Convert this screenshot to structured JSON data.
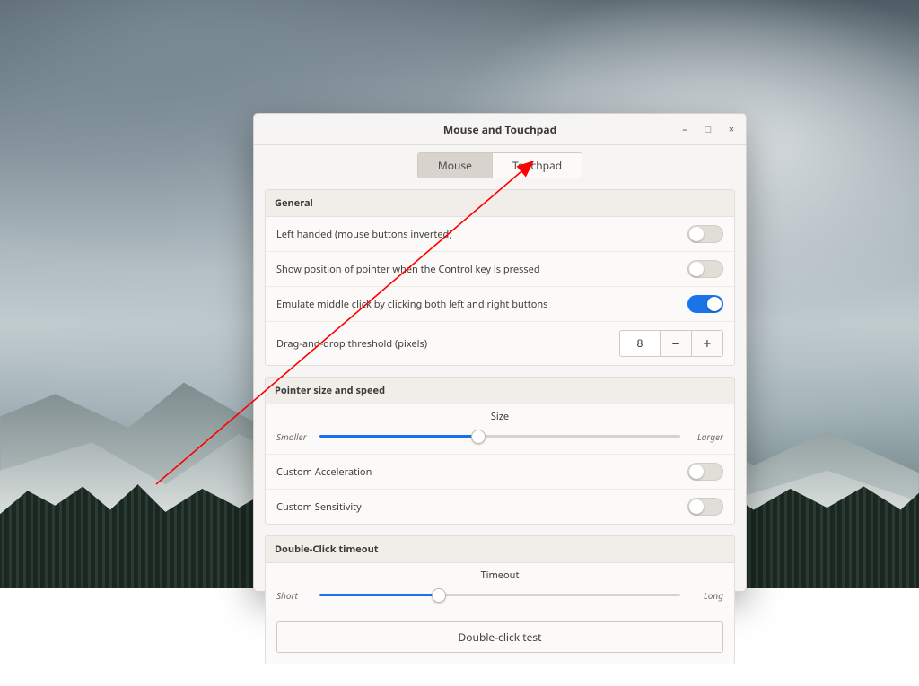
{
  "colors": {
    "accent": "#1a73e8",
    "annotation": "#ff0000"
  },
  "window": {
    "title": "Mouse and Touchpad",
    "controls": {
      "minimize": "–",
      "maximize": "□",
      "close": "×"
    },
    "tabs": [
      {
        "id": "mouse",
        "label": "Mouse",
        "active": true
      },
      {
        "id": "touchpad",
        "label": "Touchpad",
        "active": false
      }
    ]
  },
  "general": {
    "heading": "General",
    "rows": [
      {
        "id": "left-handed",
        "label": "Left handed (mouse buttons inverted)",
        "on": false
      },
      {
        "id": "show-position",
        "label": "Show position of pointer when the Control key is pressed",
        "on": false
      },
      {
        "id": "emulate-middle",
        "label": "Emulate middle click by clicking both left and right buttons",
        "on": true
      }
    ],
    "drag_threshold": {
      "label": "Drag-and-drop threshold (pixels)",
      "value": "8",
      "dec": "−",
      "inc": "+"
    }
  },
  "pointer": {
    "heading": "Pointer size and speed",
    "size": {
      "caption": "Size",
      "left": "Smaller",
      "right": "Larger",
      "percent": 44
    },
    "rows": [
      {
        "id": "custom-accel",
        "label": "Custom Acceleration",
        "on": false
      },
      {
        "id": "custom-sens",
        "label": "Custom Sensitivity",
        "on": false
      }
    ]
  },
  "doubleclick": {
    "heading": "Double-Click timeout",
    "timeout": {
      "caption": "Timeout",
      "left": "Short",
      "right": "Long",
      "percent": 33
    },
    "test_label": "Double-click test"
  },
  "annotation": {
    "from": [
      174,
      540
    ],
    "to": [
      594,
      180
    ]
  }
}
